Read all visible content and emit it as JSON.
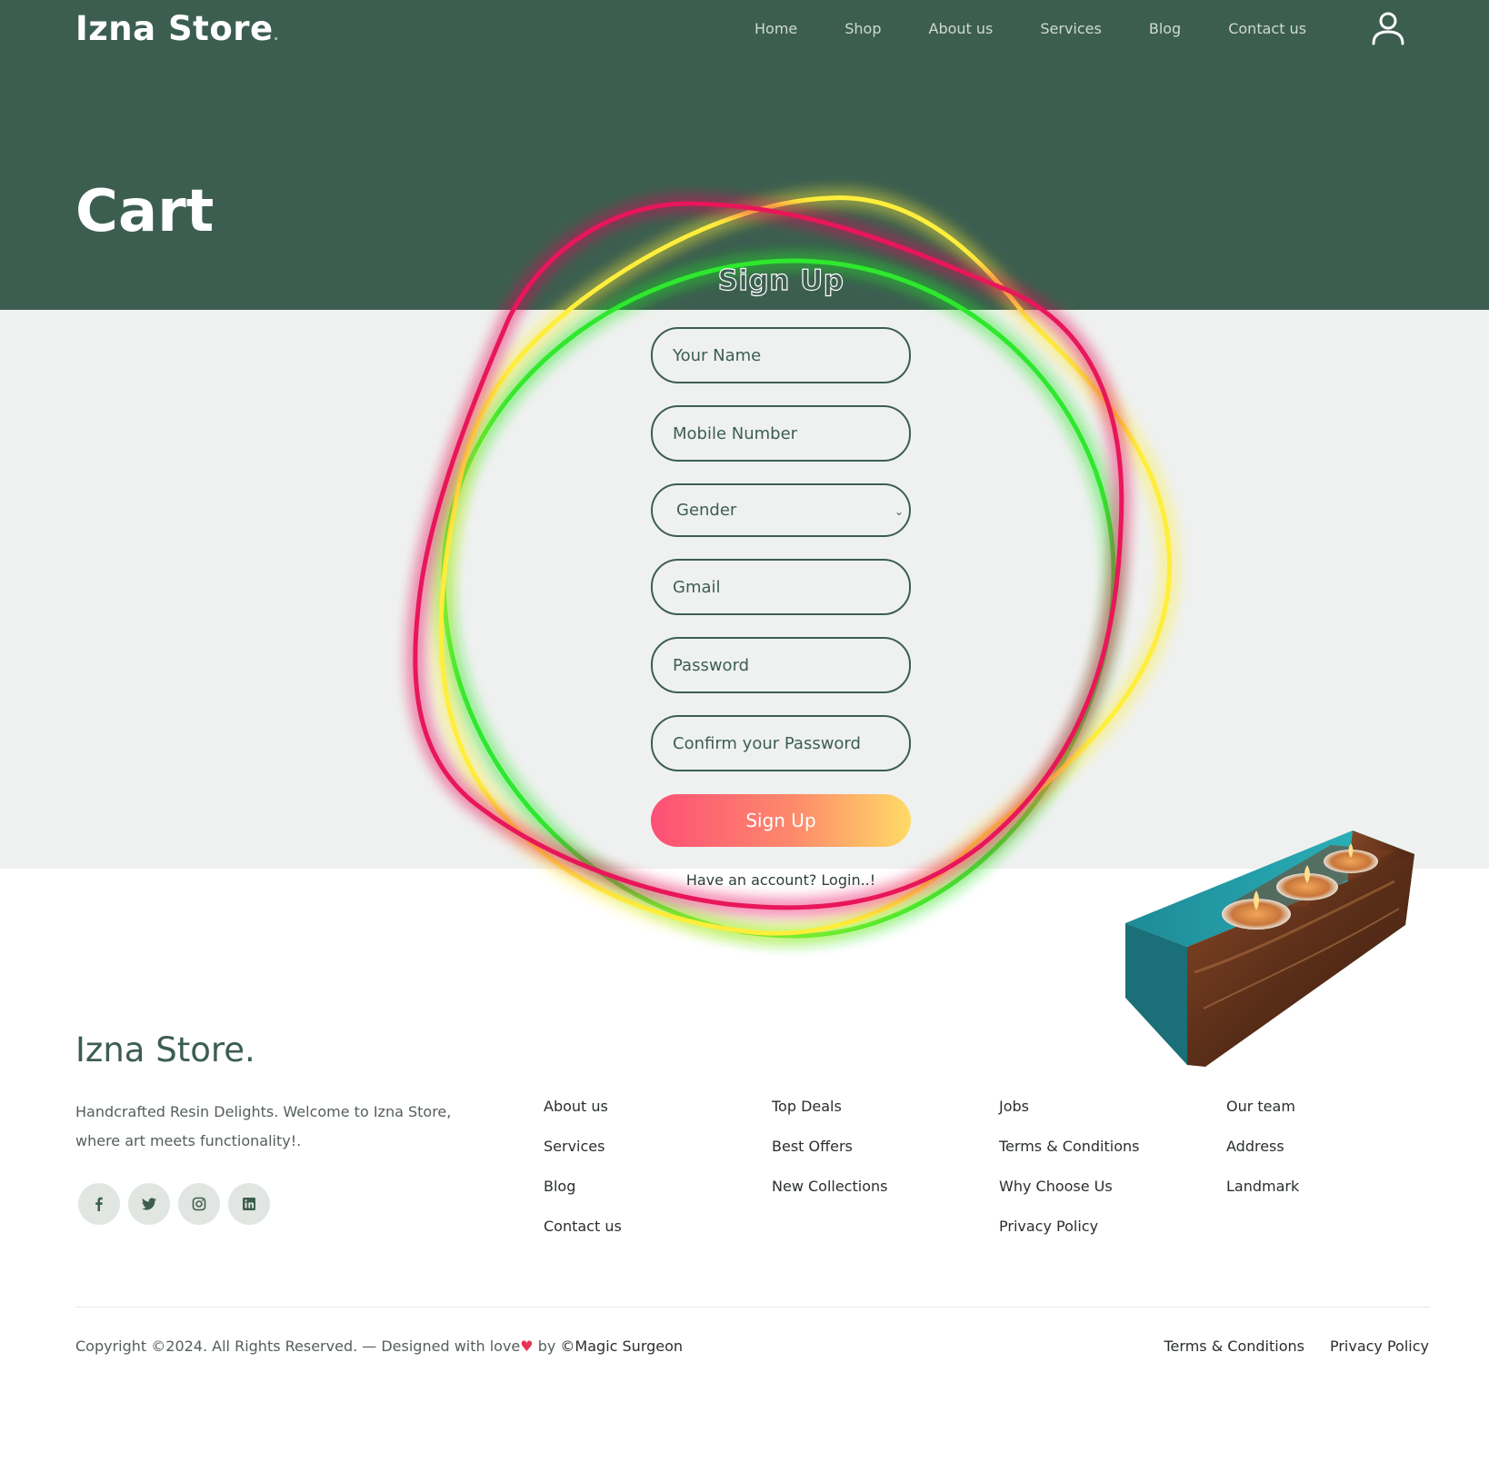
{
  "header": {
    "brand": "Izna Store",
    "brand_dot": ".",
    "nav": [
      "Home",
      "Shop",
      "About us",
      "Services",
      "Blog",
      "Contact us"
    ],
    "user_icon": "user-icon"
  },
  "hero": {
    "title": "Cart"
  },
  "signup_form": {
    "title": "Sign Up",
    "name_placeholder": "Your Name",
    "mobile_placeholder": "Mobile Number",
    "gender_selected": "Gender",
    "gmail_placeholder": "Gmail",
    "password_placeholder": "Password",
    "confirm_placeholder": "Confirm your Password",
    "submit_label": "Sign Up",
    "login_link": "Have an account? Login..!"
  },
  "footer": {
    "brand": "Izna Store.",
    "description": "Handcrafted Resin Delights. Welcome to Izna Store, where art meets functionality!.",
    "social": [
      "facebook-icon",
      "twitter-icon",
      "instagram-icon",
      "linkedin-icon"
    ],
    "columns": [
      [
        "About us",
        "Services",
        "Blog",
        "Contact us"
      ],
      [
        "Top Deals",
        "Best Offers",
        "New Collections"
      ],
      [
        "Jobs",
        "Terms & Conditions",
        "Why Choose Us",
        "Privacy Policy"
      ],
      [
        "Our team",
        "Address",
        "Landmark"
      ]
    ],
    "copyright_prefix": "Copyright ©2024. All Rights Reserved. — Designed with love",
    "copyright_by": "by",
    "copyright_author": "©Magic Surgeon",
    "bottom_links": [
      "Terms & Conditions",
      "Privacy Policy"
    ]
  },
  "colors": {
    "primary": "#3c5e50",
    "band": "#eff1f0",
    "button_gradient_start": "#fd4f76",
    "button_gradient_end": "#fedb66",
    "ring_red": "#e8195a",
    "ring_yellow": "#ffee3a",
    "ring_green": "#2de82d"
  }
}
